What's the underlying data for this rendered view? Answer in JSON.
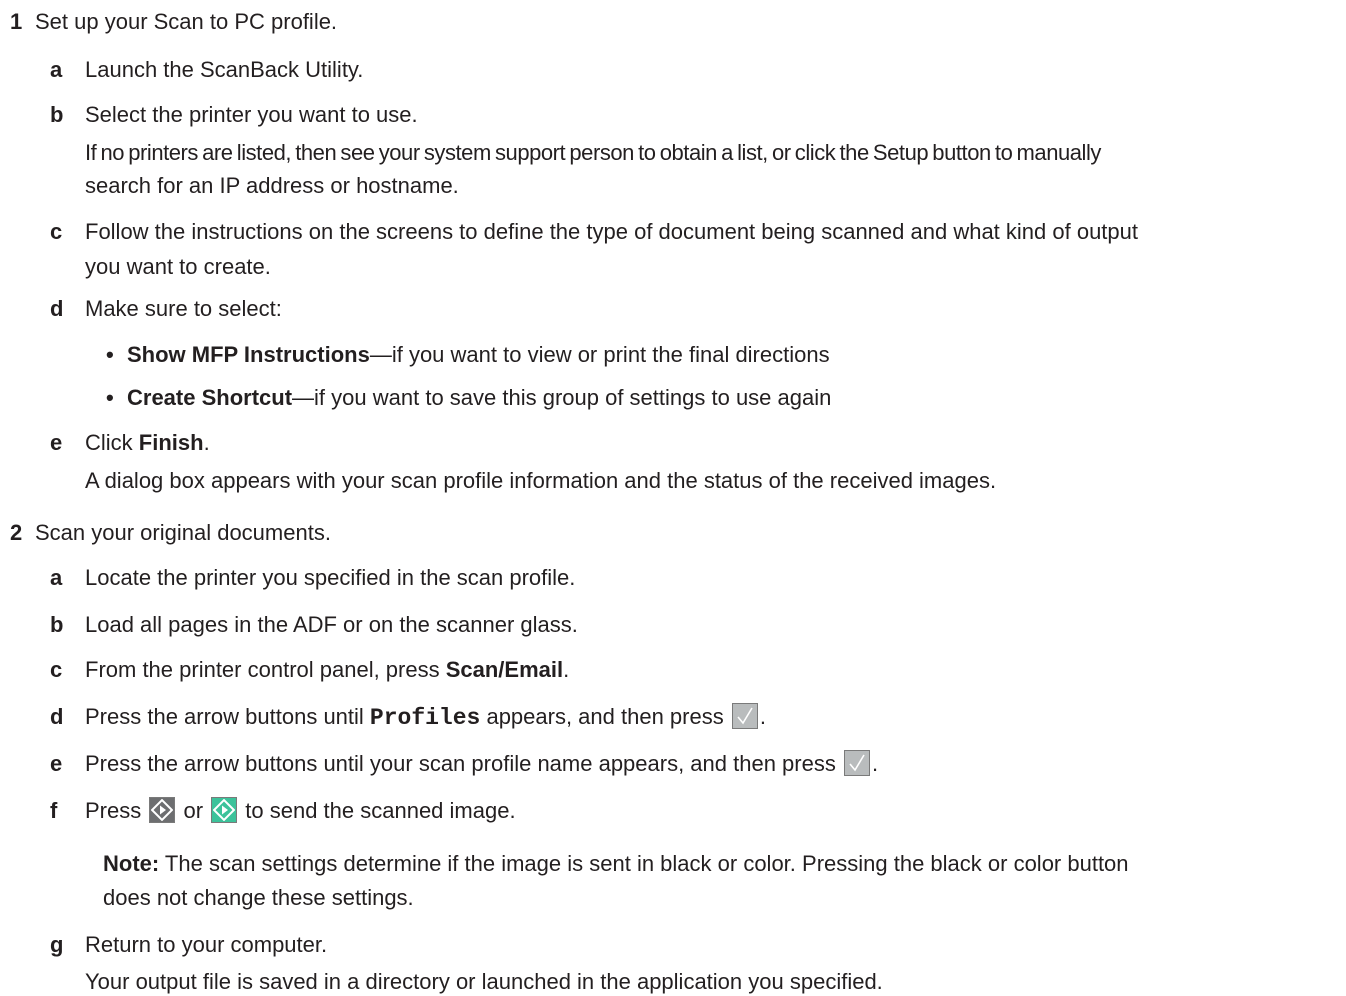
{
  "steps": [
    {
      "number": "1",
      "text": "Set up your Scan to PC profile.",
      "substeps": [
        {
          "letter": "a",
          "text": "Launch the ScanBack Utility."
        },
        {
          "letter": "b",
          "text": "Select the printer you want to use.",
          "detail_1": "If no printers are listed, then see your system support person to obtain a list, or click the Setup button to manually",
          "detail_2": "search for an IP address or hostname."
        },
        {
          "letter": "c",
          "text_1": "Follow the instructions on the screens to define the type of document being scanned and what kind of output",
          "text_2": "you want to create."
        },
        {
          "letter": "d",
          "text": "Make sure to select:",
          "bullets": [
            {
              "bold": "Show MFP Instructions",
              "rest": "—if you want to view or print the final directions"
            },
            {
              "bold": "Create Shortcut",
              "rest": "—if you want to save this group of settings to use again"
            }
          ]
        },
        {
          "letter": "e",
          "pre": "Click ",
          "bold": "Finish",
          "post": ".",
          "detail": "A dialog box appears with your scan profile information and the status of the received images."
        }
      ]
    },
    {
      "number": "2",
      "text": "Scan your original documents.",
      "substeps": [
        {
          "letter": "a",
          "text": "Locate the printer you specified in the scan profile."
        },
        {
          "letter": "b",
          "text": "Load all pages in the ADF or on the scanner glass."
        },
        {
          "letter": "c",
          "pre": "From the printer control panel, press ",
          "bold": "Scan/Email",
          "post": "."
        },
        {
          "letter": "d",
          "pre": "Press the arrow buttons until ",
          "code": "Profiles",
          "post": " appears, and then press ",
          "end": "."
        },
        {
          "letter": "e",
          "pre": "Press the arrow buttons until your scan profile name appears, and then press ",
          "end": "."
        },
        {
          "letter": "f",
          "pre": "Press ",
          "mid": " or ",
          "post": " to send the scanned image."
        },
        {
          "letter": "g",
          "text": "Return to your computer.",
          "detail": "Your output file is saved in a directory or launched in the application you specified."
        }
      ]
    }
  ],
  "note": {
    "label": "Note:",
    "text_1": " The scan settings determine if the image is sent in black or color. Pressing the black or color button",
    "text_2": "does not change these settings."
  },
  "icons": {
    "check_button": "checkmark-button-icon",
    "start_black": "start-black-button-icon",
    "start_color": "start-color-button-icon"
  },
  "colors": {
    "text": "#231f20",
    "check_button_bg": "#b9bcbd",
    "start_black_bg": "#6d6e70",
    "start_color_bg": "#3cc29a"
  }
}
